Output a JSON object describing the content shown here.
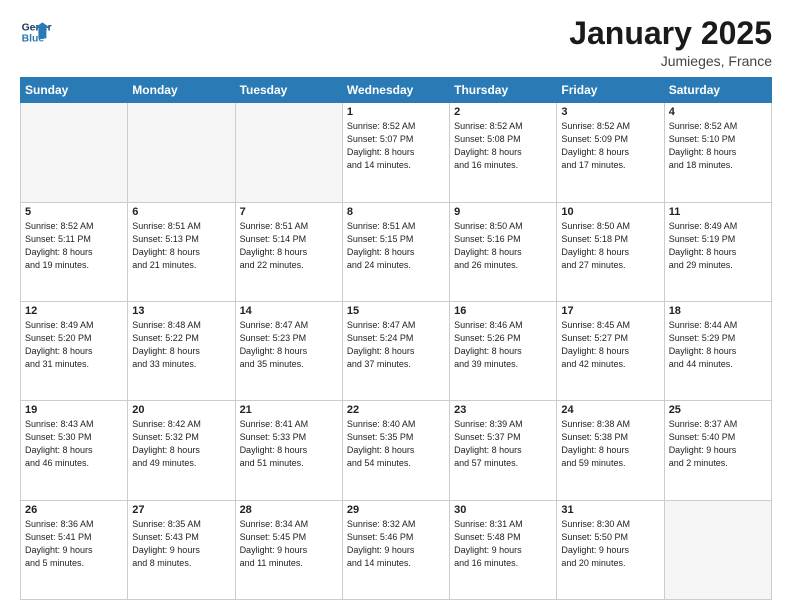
{
  "header": {
    "logo_line1": "General",
    "logo_line2": "Blue",
    "month": "January 2025",
    "location": "Jumieges, France"
  },
  "weekdays": [
    "Sunday",
    "Monday",
    "Tuesday",
    "Wednesday",
    "Thursday",
    "Friday",
    "Saturday"
  ],
  "weeks": [
    [
      {
        "day": "",
        "info": ""
      },
      {
        "day": "",
        "info": ""
      },
      {
        "day": "",
        "info": ""
      },
      {
        "day": "1",
        "info": "Sunrise: 8:52 AM\nSunset: 5:07 PM\nDaylight: 8 hours\nand 14 minutes."
      },
      {
        "day": "2",
        "info": "Sunrise: 8:52 AM\nSunset: 5:08 PM\nDaylight: 8 hours\nand 16 minutes."
      },
      {
        "day": "3",
        "info": "Sunrise: 8:52 AM\nSunset: 5:09 PM\nDaylight: 8 hours\nand 17 minutes."
      },
      {
        "day": "4",
        "info": "Sunrise: 8:52 AM\nSunset: 5:10 PM\nDaylight: 8 hours\nand 18 minutes."
      }
    ],
    [
      {
        "day": "5",
        "info": "Sunrise: 8:52 AM\nSunset: 5:11 PM\nDaylight: 8 hours\nand 19 minutes."
      },
      {
        "day": "6",
        "info": "Sunrise: 8:51 AM\nSunset: 5:13 PM\nDaylight: 8 hours\nand 21 minutes."
      },
      {
        "day": "7",
        "info": "Sunrise: 8:51 AM\nSunset: 5:14 PM\nDaylight: 8 hours\nand 22 minutes."
      },
      {
        "day": "8",
        "info": "Sunrise: 8:51 AM\nSunset: 5:15 PM\nDaylight: 8 hours\nand 24 minutes."
      },
      {
        "day": "9",
        "info": "Sunrise: 8:50 AM\nSunset: 5:16 PM\nDaylight: 8 hours\nand 26 minutes."
      },
      {
        "day": "10",
        "info": "Sunrise: 8:50 AM\nSunset: 5:18 PM\nDaylight: 8 hours\nand 27 minutes."
      },
      {
        "day": "11",
        "info": "Sunrise: 8:49 AM\nSunset: 5:19 PM\nDaylight: 8 hours\nand 29 minutes."
      }
    ],
    [
      {
        "day": "12",
        "info": "Sunrise: 8:49 AM\nSunset: 5:20 PM\nDaylight: 8 hours\nand 31 minutes."
      },
      {
        "day": "13",
        "info": "Sunrise: 8:48 AM\nSunset: 5:22 PM\nDaylight: 8 hours\nand 33 minutes."
      },
      {
        "day": "14",
        "info": "Sunrise: 8:47 AM\nSunset: 5:23 PM\nDaylight: 8 hours\nand 35 minutes."
      },
      {
        "day": "15",
        "info": "Sunrise: 8:47 AM\nSunset: 5:24 PM\nDaylight: 8 hours\nand 37 minutes."
      },
      {
        "day": "16",
        "info": "Sunrise: 8:46 AM\nSunset: 5:26 PM\nDaylight: 8 hours\nand 39 minutes."
      },
      {
        "day": "17",
        "info": "Sunrise: 8:45 AM\nSunset: 5:27 PM\nDaylight: 8 hours\nand 42 minutes."
      },
      {
        "day": "18",
        "info": "Sunrise: 8:44 AM\nSunset: 5:29 PM\nDaylight: 8 hours\nand 44 minutes."
      }
    ],
    [
      {
        "day": "19",
        "info": "Sunrise: 8:43 AM\nSunset: 5:30 PM\nDaylight: 8 hours\nand 46 minutes."
      },
      {
        "day": "20",
        "info": "Sunrise: 8:42 AM\nSunset: 5:32 PM\nDaylight: 8 hours\nand 49 minutes."
      },
      {
        "day": "21",
        "info": "Sunrise: 8:41 AM\nSunset: 5:33 PM\nDaylight: 8 hours\nand 51 minutes."
      },
      {
        "day": "22",
        "info": "Sunrise: 8:40 AM\nSunset: 5:35 PM\nDaylight: 8 hours\nand 54 minutes."
      },
      {
        "day": "23",
        "info": "Sunrise: 8:39 AM\nSunset: 5:37 PM\nDaylight: 8 hours\nand 57 minutes."
      },
      {
        "day": "24",
        "info": "Sunrise: 8:38 AM\nSunset: 5:38 PM\nDaylight: 8 hours\nand 59 minutes."
      },
      {
        "day": "25",
        "info": "Sunrise: 8:37 AM\nSunset: 5:40 PM\nDaylight: 9 hours\nand 2 minutes."
      }
    ],
    [
      {
        "day": "26",
        "info": "Sunrise: 8:36 AM\nSunset: 5:41 PM\nDaylight: 9 hours\nand 5 minutes."
      },
      {
        "day": "27",
        "info": "Sunrise: 8:35 AM\nSunset: 5:43 PM\nDaylight: 9 hours\nand 8 minutes."
      },
      {
        "day": "28",
        "info": "Sunrise: 8:34 AM\nSunset: 5:45 PM\nDaylight: 9 hours\nand 11 minutes."
      },
      {
        "day": "29",
        "info": "Sunrise: 8:32 AM\nSunset: 5:46 PM\nDaylight: 9 hours\nand 14 minutes."
      },
      {
        "day": "30",
        "info": "Sunrise: 8:31 AM\nSunset: 5:48 PM\nDaylight: 9 hours\nand 16 minutes."
      },
      {
        "day": "31",
        "info": "Sunrise: 8:30 AM\nSunset: 5:50 PM\nDaylight: 9 hours\nand 20 minutes."
      },
      {
        "day": "",
        "info": ""
      }
    ]
  ]
}
